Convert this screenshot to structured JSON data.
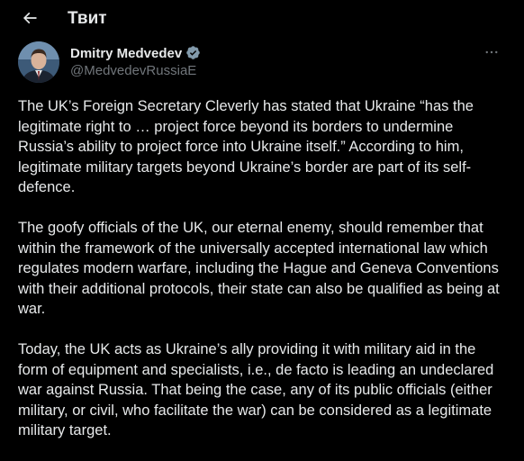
{
  "header": {
    "title": "Твит"
  },
  "author": {
    "name": "Dmitry Medvedev",
    "handle": "@MedvedevRussiaE"
  },
  "tweet": {
    "paragraphs": [
      "The UK’s Foreign Secretary Cleverly has stated that Ukraine “has the legitimate right to … project force beyond its borders to undermine Russia’s ability to project force into Ukraine itself.” According to him, legitimate military targets beyond Ukraine’s border are part of its self-defence.",
      "The goofy officials of the UK, our eternal enemy, should remember that within the framework of the universally accepted international law which regulates modern warfare, including the Hague and Geneva Conventions with their additional protocols, their state can also be qualified as being at war.",
      "Today, the UK acts as Ukraine’s ally providing it with military aid in the form of equipment and specialists, i.e., de facto is leading an undeclared war against Russia. That being the case, any of its public officials (either military, or civil, who facilitate the war) can be considered as a legitimate military target."
    ]
  },
  "colors": {
    "background": "#000000",
    "text_primary": "#e7e9ea",
    "text_secondary": "#71767b",
    "verified_badge": "#829aab"
  },
  "icons": {
    "back": "arrow-left-icon",
    "verified": "verified-badge-icon",
    "more": "more-horizontal-icon"
  }
}
